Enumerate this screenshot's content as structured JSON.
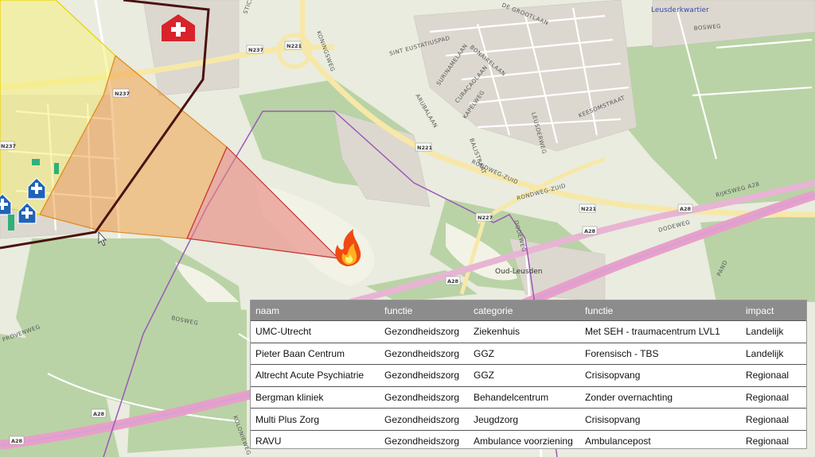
{
  "map": {
    "district_label": "Leusderkwartier",
    "place_label": "Oud-Leusden",
    "street_labels": {
      "stichtse_rotonde": "STICHTSE ROTONDE",
      "de_grootlaan": "DE GROOTLAAN",
      "sint_eustatiusplein": "SINT EUSTATIUSPAD",
      "suriname": "SURINAMELAAN",
      "bonaire": "BONAIRELAAN",
      "curacao": "CURAÇAOLAAN",
      "kapelweg": "KAPELWEG",
      "aruba": "ARUBALAAN",
      "balistraat": "BALISTRAAT",
      "leusderweg": "LEUSDERWEG",
      "keesomstraat": "KEESOMSTRAAT",
      "bosweg_top": "BOSWEG",
      "rondweg_zuid_1": "RONDWEG-ZUID",
      "rondweg_zuid_2": "RONDWEG-ZUID",
      "rijksweg": "RIJKSWEG A28",
      "dodeweg_1": "DODEWEG",
      "dodeweg_2": "DODEWEG",
      "bosweg_bottom": "BOSWEG",
      "provenweg": "PROVENWEG",
      "koloniestraat": "KOLONIEWEG",
      "pand": "PAND",
      "kruisweg": "KONINGSWEG"
    },
    "road_shields": [
      "N237",
      "N221",
      "N237",
      "N237",
      "N221",
      "N227",
      "N221",
      "A28",
      "A28",
      "A28",
      "A28",
      "A28"
    ],
    "colors": {
      "zone_yellow": "#f6f07a",
      "zone_orange": "#f0a24a",
      "zone_red": "#e8847c",
      "perimeter": "#4a1212",
      "hospital_red": "#d8232a",
      "care_blue": "#1f63b8"
    },
    "icons": [
      "hospital-icon",
      "care-facility-icon",
      "care-facility-icon",
      "care-facility-icon",
      "fire-icon",
      "mouse-cursor-icon"
    ]
  },
  "table": {
    "headers": [
      "naam",
      "functie",
      "categorie",
      "functie",
      "impact"
    ],
    "rows": [
      [
        "UMC-Utrecht",
        "Gezondheidszorg",
        "Ziekenhuis",
        "Met SEH - traumacentrum LVL1",
        "Landelijk"
      ],
      [
        "Pieter Baan Centrum",
        "Gezondheidszorg",
        "GGZ",
        "Forensisch - TBS",
        "Landelijk"
      ],
      [
        "Altrecht Acute Psychiatrie",
        "Gezondheidszorg",
        "GGZ",
        "Crisisopvang",
        "Regionaal"
      ],
      [
        "Bergman kliniek",
        "Gezondheidszorg",
        "Behandelcentrum",
        "Zonder overnachting",
        "Regionaal"
      ],
      [
        "Multi Plus Zorg",
        "Gezondheidszorg",
        "Jeugdzorg",
        "Crisisopvang",
        "Regionaal"
      ],
      [
        "RAVU",
        "Gezondheidszorg",
        "Ambulance voorziening",
        "Ambulancepost",
        "Regionaal"
      ]
    ]
  }
}
